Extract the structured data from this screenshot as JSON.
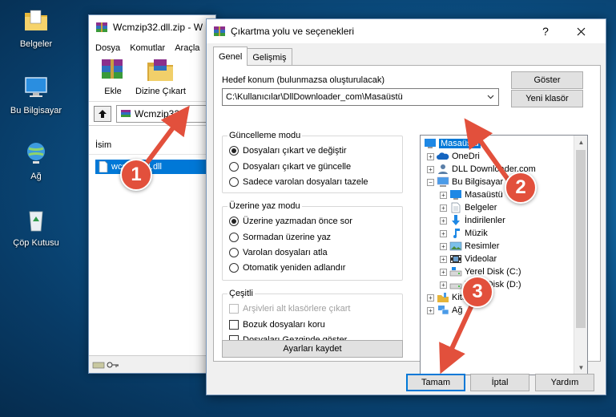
{
  "desktop": {
    "icons": [
      {
        "label": "Belgeler",
        "icon": "folder-documents-icon"
      },
      {
        "label": "Bu Bilgisayar",
        "icon": "computer-icon"
      },
      {
        "label": "Ağ",
        "icon": "network-icon"
      },
      {
        "label": "Çöp Kutusu",
        "icon": "recycle-bin-icon"
      }
    ]
  },
  "winrar": {
    "title": "Wcmzip32.dll.zip - W",
    "menu": [
      "Dosya",
      "Komutlar",
      "Araçla"
    ],
    "toolbar": {
      "add_label": "Ekle",
      "extract_label": "Dizine Çıkart"
    },
    "path": "Wcmzip32.",
    "column_name": "İsim",
    "file": "wcmzip32.dll"
  },
  "dialog": {
    "title": "Çıkartma yolu ve seçenekleri",
    "tabs": [
      "Genel",
      "Gelişmiş"
    ],
    "dest_label": "Hedef konum (bulunmazsa oluşturulacak)",
    "dest_value": "C:\\Kullanıcılar\\DllDownloader_com\\Masaüstü",
    "show_button": "Göster",
    "new_folder_button": "Yeni klasör",
    "update_group": {
      "title": "Güncelleme modu",
      "options": [
        "Dosyaları çıkart ve değiştir",
        "Dosyaları çıkart ve güncelle",
        "Sadece varolan dosyaları tazele"
      ],
      "selected": 0
    },
    "overwrite_group": {
      "title": "Üzerine yaz modu",
      "options": [
        "Üzerine yazmadan önce sor",
        "Sormadan üzerine yaz",
        "Varolan dosyaları atla",
        "Otomatik yeniden adlandır"
      ],
      "selected": 0
    },
    "misc_group": {
      "title": "Çeşitli",
      "options": [
        "Arşivleri alt klasörlere çıkart",
        "Bozuk dosyaları koru",
        "Dosyaları Gezginde göster"
      ],
      "disabled": [
        true,
        false,
        false
      ]
    },
    "save_settings_button": "Ayarları kaydet",
    "tree": [
      {
        "label": "Masaüstü",
        "icon": "desktop-icon",
        "selected": true
      },
      {
        "label": "OneDri",
        "icon": "onedrive-icon"
      },
      {
        "label": "DLL Downloader.com",
        "icon": "user-icon"
      },
      {
        "label": "Bu Bilgisayar",
        "icon": "computer-icon"
      },
      {
        "label": "Masaüstü",
        "icon": "desktop-icon"
      },
      {
        "label": "Belgeler",
        "icon": "documents-icon"
      },
      {
        "label": "İndirilenler",
        "icon": "downloads-icon"
      },
      {
        "label": "Müzik",
        "icon": "music-icon"
      },
      {
        "label": "Resimler",
        "icon": "pictures-icon"
      },
      {
        "label": "Videolar",
        "icon": "videos-icon"
      },
      {
        "label": "Yerel Disk (C:)",
        "icon": "drive-icon"
      },
      {
        "label": "Yerel Disk (D:)",
        "icon": "drive-icon"
      },
      {
        "label": "Kitaplıklar",
        "icon": "libraries-icon"
      },
      {
        "label": "Ağ",
        "icon": "network-icon"
      }
    ],
    "ok_button": "Tamam",
    "cancel_button": "İptal",
    "help_button": "Yardım"
  },
  "annotations": [
    "1",
    "2",
    "3"
  ],
  "colors": {
    "accent": "#0078d7",
    "annotation": "#e2503c"
  }
}
